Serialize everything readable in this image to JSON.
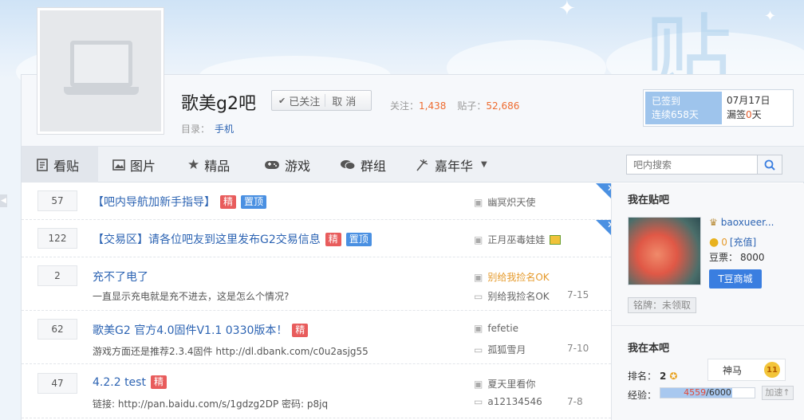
{
  "forum": {
    "name": "歌美g2吧",
    "follow_label": "已关注",
    "unfollow_label": "取 消",
    "follow_count_label": "关注：",
    "follow_count": "1,438",
    "post_count_label": "贴子：",
    "post_count": "52,686",
    "catalog_label": "目录：",
    "catalog_value": "手机"
  },
  "signin": {
    "status": "已签到",
    "streak": "连续658天",
    "date": "07月17日",
    "missed_prefix": "漏签",
    "missed_count": "0",
    "missed_suffix": "天"
  },
  "nav": {
    "items": [
      {
        "label": "看贴",
        "icon": "document-icon"
      },
      {
        "label": "图片",
        "icon": "image-icon"
      },
      {
        "label": "精品",
        "icon": "star-icon"
      },
      {
        "label": "游戏",
        "icon": "gamepad-icon"
      },
      {
        "label": "群组",
        "icon": "chat-bubbles-icon"
      },
      {
        "label": "嘉年华",
        "icon": "fireworks-icon"
      }
    ],
    "search_placeholder": "吧内搜索"
  },
  "threads": [
    {
      "replies": "57",
      "title": "【吧内导航加新手指导】",
      "tags": [
        "精",
        "置顶"
      ],
      "author": "幽冥炽天使",
      "pinned": true
    },
    {
      "replies": "122",
      "title": "【交易区】请各位吧友到这里发布G2交易信息",
      "tags": [
        "精",
        "置顶"
      ],
      "author": "正月巫毒娃娃",
      "pinned": true
    },
    {
      "replies": "2",
      "title": "充不了电了",
      "tags": [],
      "abstract": "一直显示充电就是充不进去，这是怎么个情况?",
      "author": "别给我捡名OK",
      "last_reply": "别给我捡名OK",
      "time": "7-15"
    },
    {
      "replies": "62",
      "title": "歌美G2 官方4.0固件V1.1 0330版本！",
      "tags": [
        "精"
      ],
      "abstract": "游戏方面还是推荐2.3.4固件 http://dl.dbank.com/c0u2asjg55",
      "author": "fefetie",
      "last_reply": "孤狐雪月",
      "time": "7-10"
    },
    {
      "replies": "47",
      "title": "4.2.2 test",
      "tags": [
        "精"
      ],
      "abstract": "链接: http://pan.baidu.com/s/1gdzg2DP 密码: p8jq",
      "author": "夏天里看你",
      "last_reply": "a12134546",
      "time": "7-8"
    }
  ],
  "aside": {
    "my_forum_title": "我在贴吧",
    "username": "baoxueer...",
    "tdou_count": "0",
    "recharge_label": "[充值]",
    "douquan_label": "豆票：",
    "douquan_value": "8000",
    "mall_label": "T豆商城",
    "badge_label": "铭牌：未领取",
    "in_forum_title": "我在本吧",
    "rank_label": "排名：",
    "rank_value": "2",
    "title_name": "神马",
    "level": "11",
    "exp_label": "经验：",
    "exp_current": "4559",
    "exp_total": "/6000",
    "exp_fraction": 0.76,
    "speed_label": "加速"
  },
  "colors": {
    "link": "#2d64b3",
    "accent_orange": "#ee6b2f",
    "tag_red": "#e85c5c",
    "tag_blue": "#4a90e2",
    "signin_blue": "#9ec4ec"
  }
}
